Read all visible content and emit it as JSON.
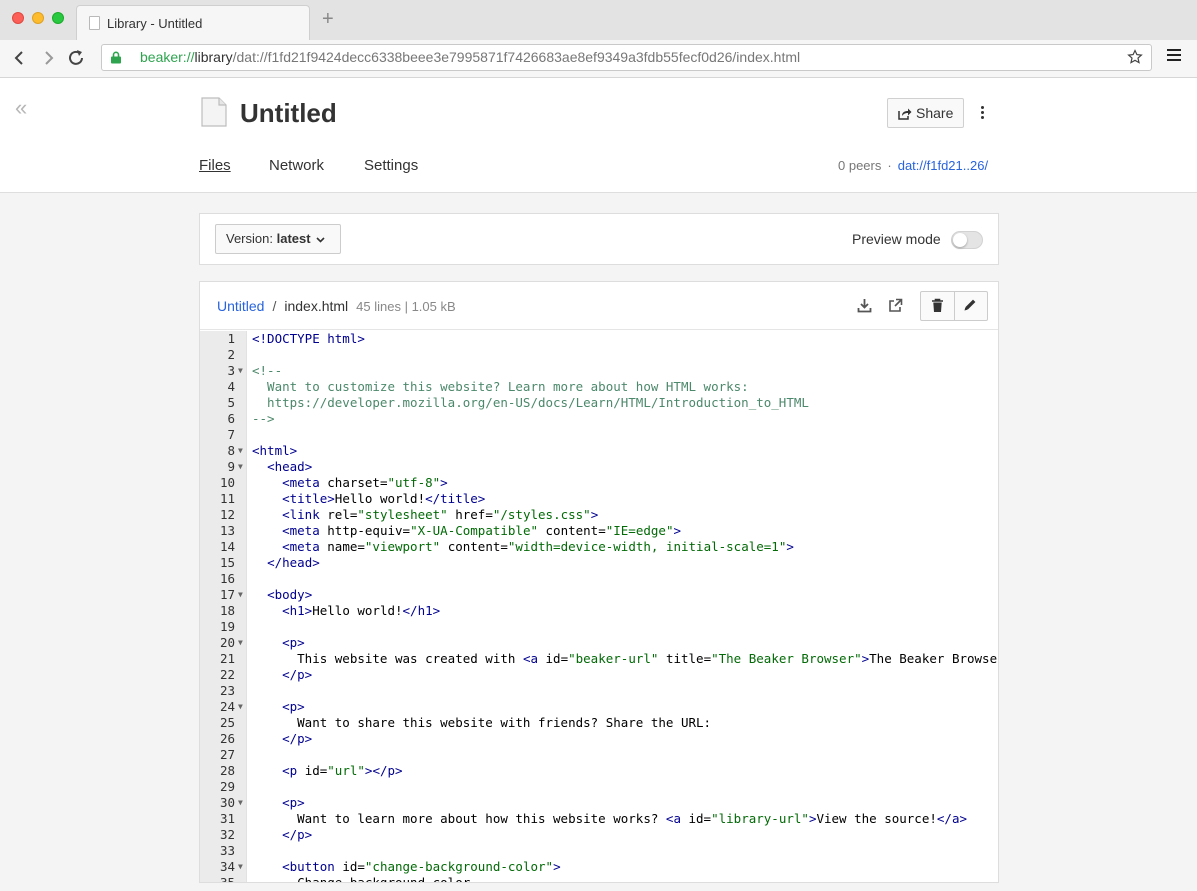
{
  "browser": {
    "tab_title": "Library - Untitled",
    "new_tab": "+",
    "url_scheme": "beaker://",
    "url_host": "library",
    "url_path": "/dat://f1fd21f9424decc6338beee3e7995871f7426683ae8ef9349a3fdb55fecf0d26/index.html"
  },
  "header": {
    "title": "Untitled",
    "share_label": "Share",
    "tabs": [
      {
        "label": "Files",
        "active": true
      },
      {
        "label": "Network",
        "active": false
      },
      {
        "label": "Settings",
        "active": false
      }
    ],
    "peers": "0 peers",
    "dot": "·",
    "dat_short": "dat://f1fd21..26/"
  },
  "version_panel": {
    "version_prefix": "Version:",
    "version_value": "latest",
    "preview_label": "Preview mode",
    "preview_enabled": false
  },
  "file": {
    "breadcrumb_root": "Untitled",
    "separator": "/",
    "filename": "index.html",
    "meta": "45 lines | 1.05 kB"
  },
  "code_lines": [
    {
      "n": "1",
      "fold": false,
      "tokens": [
        {
          "t": "tg",
          "v": "<!DOCTYPE html>"
        }
      ]
    },
    {
      "n": "2",
      "fold": false,
      "tokens": []
    },
    {
      "n": "3",
      "fold": true,
      "tokens": [
        {
          "t": "cm",
          "v": "<!--"
        }
      ]
    },
    {
      "n": "4",
      "fold": false,
      "tokens": [
        {
          "t": "cm",
          "v": "  Want to customize this website? Learn more about how HTML works:"
        }
      ]
    },
    {
      "n": "5",
      "fold": false,
      "tokens": [
        {
          "t": "cm",
          "v": "  https://developer.mozilla.org/en-US/docs/Learn/HTML/Introduction_to_HTML"
        }
      ]
    },
    {
      "n": "6",
      "fold": false,
      "tokens": [
        {
          "t": "cm",
          "v": "-->"
        }
      ]
    },
    {
      "n": "7",
      "fold": false,
      "tokens": []
    },
    {
      "n": "8",
      "fold": true,
      "tokens": [
        {
          "t": "tg",
          "v": "<html>"
        }
      ]
    },
    {
      "n": "9",
      "fold": true,
      "tokens": [
        {
          "t": "at",
          "v": "  "
        },
        {
          "t": "tg",
          "v": "<head>"
        }
      ]
    },
    {
      "n": "10",
      "fold": false,
      "tokens": [
        {
          "t": "at",
          "v": "    "
        },
        {
          "t": "tg",
          "v": "<meta"
        },
        {
          "t": "at",
          "v": " charset="
        },
        {
          "t": "st",
          "v": "\"utf-8\""
        },
        {
          "t": "tg",
          "v": ">"
        }
      ]
    },
    {
      "n": "11",
      "fold": false,
      "tokens": [
        {
          "t": "at",
          "v": "    "
        },
        {
          "t": "tg",
          "v": "<title>"
        },
        {
          "t": "at",
          "v": "Hello world!"
        },
        {
          "t": "tg",
          "v": "</title>"
        }
      ]
    },
    {
      "n": "12",
      "fold": false,
      "tokens": [
        {
          "t": "at",
          "v": "    "
        },
        {
          "t": "tg",
          "v": "<link"
        },
        {
          "t": "at",
          "v": " rel="
        },
        {
          "t": "st",
          "v": "\"stylesheet\""
        },
        {
          "t": "at",
          "v": " href="
        },
        {
          "t": "st",
          "v": "\"/styles.css\""
        },
        {
          "t": "tg",
          "v": ">"
        }
      ]
    },
    {
      "n": "13",
      "fold": false,
      "tokens": [
        {
          "t": "at",
          "v": "    "
        },
        {
          "t": "tg",
          "v": "<meta"
        },
        {
          "t": "at",
          "v": " http-equiv="
        },
        {
          "t": "st",
          "v": "\"X-UA-Compatible\""
        },
        {
          "t": "at",
          "v": " content="
        },
        {
          "t": "st",
          "v": "\"IE=edge\""
        },
        {
          "t": "tg",
          "v": ">"
        }
      ]
    },
    {
      "n": "14",
      "fold": false,
      "tokens": [
        {
          "t": "at",
          "v": "    "
        },
        {
          "t": "tg",
          "v": "<meta"
        },
        {
          "t": "at",
          "v": " name="
        },
        {
          "t": "st",
          "v": "\"viewport\""
        },
        {
          "t": "at",
          "v": " content="
        },
        {
          "t": "st",
          "v": "\"width=device-width, initial-scale=1\""
        },
        {
          "t": "tg",
          "v": ">"
        }
      ]
    },
    {
      "n": "15",
      "fold": false,
      "tokens": [
        {
          "t": "at",
          "v": "  "
        },
        {
          "t": "tg",
          "v": "</head>"
        }
      ]
    },
    {
      "n": "16",
      "fold": false,
      "tokens": []
    },
    {
      "n": "17",
      "fold": true,
      "tokens": [
        {
          "t": "at",
          "v": "  "
        },
        {
          "t": "tg",
          "v": "<body>"
        }
      ]
    },
    {
      "n": "18",
      "fold": false,
      "tokens": [
        {
          "t": "at",
          "v": "    "
        },
        {
          "t": "tg",
          "v": "<h1>"
        },
        {
          "t": "at",
          "v": "Hello world!"
        },
        {
          "t": "tg",
          "v": "</h1>"
        }
      ]
    },
    {
      "n": "19",
      "fold": false,
      "tokens": []
    },
    {
      "n": "20",
      "fold": true,
      "tokens": [
        {
          "t": "at",
          "v": "    "
        },
        {
          "t": "tg",
          "v": "<p>"
        }
      ]
    },
    {
      "n": "21",
      "fold": false,
      "tokens": [
        {
          "t": "at",
          "v": "      This website was created with "
        },
        {
          "t": "tg",
          "v": "<a"
        },
        {
          "t": "at",
          "v": " id="
        },
        {
          "t": "st",
          "v": "\"beaker-url\""
        },
        {
          "t": "at",
          "v": " title="
        },
        {
          "t": "st",
          "v": "\"The Beaker Browser\""
        },
        {
          "t": "tg",
          "v": ">"
        },
        {
          "t": "at",
          "v": "The Beaker Browser"
        },
        {
          "t": "tg",
          "v": "</"
        }
      ]
    },
    {
      "n": "22",
      "fold": false,
      "tokens": [
        {
          "t": "at",
          "v": "    "
        },
        {
          "t": "tg",
          "v": "</p>"
        }
      ]
    },
    {
      "n": "23",
      "fold": false,
      "tokens": []
    },
    {
      "n": "24",
      "fold": true,
      "tokens": [
        {
          "t": "at",
          "v": "    "
        },
        {
          "t": "tg",
          "v": "<p>"
        }
      ]
    },
    {
      "n": "25",
      "fold": false,
      "tokens": [
        {
          "t": "at",
          "v": "      Want to share this website with friends? Share the URL:"
        }
      ]
    },
    {
      "n": "26",
      "fold": false,
      "tokens": [
        {
          "t": "at",
          "v": "    "
        },
        {
          "t": "tg",
          "v": "</p>"
        }
      ]
    },
    {
      "n": "27",
      "fold": false,
      "tokens": []
    },
    {
      "n": "28",
      "fold": false,
      "tokens": [
        {
          "t": "at",
          "v": "    "
        },
        {
          "t": "tg",
          "v": "<p"
        },
        {
          "t": "at",
          "v": " id="
        },
        {
          "t": "st",
          "v": "\"url\""
        },
        {
          "t": "tg",
          "v": "></p>"
        }
      ]
    },
    {
      "n": "29",
      "fold": false,
      "tokens": []
    },
    {
      "n": "30",
      "fold": true,
      "tokens": [
        {
          "t": "at",
          "v": "    "
        },
        {
          "t": "tg",
          "v": "<p>"
        }
      ]
    },
    {
      "n": "31",
      "fold": false,
      "tokens": [
        {
          "t": "at",
          "v": "      Want to learn more about how this website works? "
        },
        {
          "t": "tg",
          "v": "<a"
        },
        {
          "t": "at",
          "v": " id="
        },
        {
          "t": "st",
          "v": "\"library-url\""
        },
        {
          "t": "tg",
          "v": ">"
        },
        {
          "t": "at",
          "v": "View the source!"
        },
        {
          "t": "tg",
          "v": "</a>"
        }
      ]
    },
    {
      "n": "32",
      "fold": false,
      "tokens": [
        {
          "t": "at",
          "v": "    "
        },
        {
          "t": "tg",
          "v": "</p>"
        }
      ]
    },
    {
      "n": "33",
      "fold": false,
      "tokens": []
    },
    {
      "n": "34",
      "fold": true,
      "tokens": [
        {
          "t": "at",
          "v": "    "
        },
        {
          "t": "tg",
          "v": "<button"
        },
        {
          "t": "at",
          "v": " id="
        },
        {
          "t": "st",
          "v": "\"change-background-color\""
        },
        {
          "t": "tg",
          "v": ">"
        }
      ]
    },
    {
      "n": "35",
      "fold": false,
      "tokens": [
        {
          "t": "at",
          "v": "      Change background color"
        }
      ]
    }
  ],
  "colors": {
    "link": "#2864dc",
    "tag": "#000090",
    "string": "#036a07",
    "comment": "#4c886b",
    "secure_green": "#2ea44f"
  }
}
